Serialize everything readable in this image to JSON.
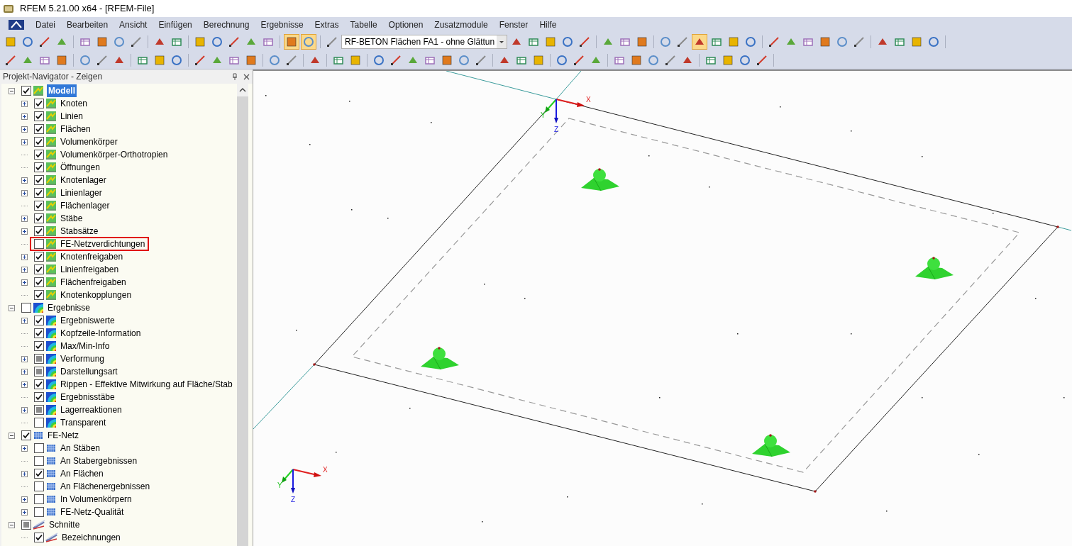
{
  "window": {
    "title": "RFEM 5.21.00 x64 - [RFEM-File]"
  },
  "menu": [
    "Datei",
    "Bearbeiten",
    "Ansicht",
    "Einfügen",
    "Berechnung",
    "Ergebnisse",
    "Extras",
    "Tabelle",
    "Optionen",
    "Zusatzmodule",
    "Fenster",
    "Hilfe"
  ],
  "toolbar": {
    "case_dropdown": "RF-BETON Flächen FA1 - ohne Glättun"
  },
  "navigator": {
    "title": "Projekt-Navigator - Zeigen",
    "tree": [
      {
        "label": "Modell",
        "kind": "model",
        "checked": true,
        "mixed": false,
        "expanded": true,
        "selected": true,
        "highlighted": false,
        "children": [
          {
            "label": "Knoten",
            "kind": "model",
            "checked": true,
            "mixed": false,
            "expandable": true,
            "selected": false,
            "highlighted": false
          },
          {
            "label": "Linien",
            "kind": "model",
            "checked": true,
            "mixed": false,
            "expandable": true,
            "selected": false,
            "highlighted": false
          },
          {
            "label": "Flächen",
            "kind": "model",
            "checked": true,
            "mixed": false,
            "expandable": true,
            "selected": false,
            "highlighted": false
          },
          {
            "label": "Volumenkörper",
            "kind": "model",
            "checked": true,
            "mixed": false,
            "expandable": true,
            "selected": false,
            "highlighted": false
          },
          {
            "label": "Volumenkörper-Orthotropien",
            "kind": "model",
            "checked": true,
            "mixed": false,
            "expandable": false,
            "selected": false,
            "highlighted": false
          },
          {
            "label": "Öffnungen",
            "kind": "model",
            "checked": true,
            "mixed": false,
            "expandable": false,
            "selected": false,
            "highlighted": false
          },
          {
            "label": "Knotenlager",
            "kind": "model",
            "checked": true,
            "mixed": false,
            "expandable": true,
            "selected": false,
            "highlighted": false
          },
          {
            "label": "Linienlager",
            "kind": "model",
            "checked": true,
            "mixed": false,
            "expandable": true,
            "selected": false,
            "highlighted": false
          },
          {
            "label": "Flächenlager",
            "kind": "model",
            "checked": true,
            "mixed": false,
            "expandable": false,
            "selected": false,
            "highlighted": false
          },
          {
            "label": "Stäbe",
            "kind": "model",
            "checked": true,
            "mixed": false,
            "expandable": true,
            "selected": false,
            "highlighted": false
          },
          {
            "label": "Stabsätze",
            "kind": "model",
            "checked": true,
            "mixed": false,
            "expandable": true,
            "selected": false,
            "highlighted": false
          },
          {
            "label": "FE-Netzverdichtungen",
            "kind": "model",
            "checked": false,
            "mixed": false,
            "expandable": false,
            "selected": false,
            "highlighted": true
          },
          {
            "label": "Knotenfreigaben",
            "kind": "model",
            "checked": true,
            "mixed": false,
            "expandable": true,
            "selected": false,
            "highlighted": false
          },
          {
            "label": "Linienfreigaben",
            "kind": "model",
            "checked": true,
            "mixed": false,
            "expandable": true,
            "selected": false,
            "highlighted": false
          },
          {
            "label": "Flächenfreigaben",
            "kind": "model",
            "checked": true,
            "mixed": false,
            "expandable": true,
            "selected": false,
            "highlighted": false
          },
          {
            "label": "Knotenkopplungen",
            "kind": "model",
            "checked": true,
            "mixed": false,
            "expandable": false,
            "selected": false,
            "highlighted": false
          }
        ]
      },
      {
        "label": "Ergebnisse",
        "kind": "results",
        "checked": false,
        "mixed": false,
        "expanded": true,
        "selected": false,
        "highlighted": false,
        "children": [
          {
            "label": "Ergebniswerte",
            "kind": "results",
            "checked": true,
            "mixed": false,
            "expandable": true,
            "selected": false,
            "highlighted": false
          },
          {
            "label": "Kopfzeile-Information",
            "kind": "results",
            "checked": true,
            "mixed": false,
            "expandable": false,
            "selected": false,
            "highlighted": false
          },
          {
            "label": "Max/Min-Info",
            "kind": "results",
            "checked": true,
            "mixed": false,
            "expandable": false,
            "selected": false,
            "highlighted": false
          },
          {
            "label": "Verformung",
            "kind": "results",
            "checked": false,
            "mixed": true,
            "expandable": true,
            "selected": false,
            "highlighted": false
          },
          {
            "label": "Darstellungsart",
            "kind": "results",
            "checked": false,
            "mixed": true,
            "expandable": true,
            "selected": false,
            "highlighted": false
          },
          {
            "label": "Rippen - Effektive Mitwirkung auf Fläche/Stab",
            "kind": "results",
            "checked": true,
            "mixed": false,
            "expandable": true,
            "selected": false,
            "highlighted": false
          },
          {
            "label": "Ergebnisstäbe",
            "kind": "results",
            "checked": true,
            "mixed": false,
            "expandable": false,
            "selected": false,
            "highlighted": false
          },
          {
            "label": "Lagerreaktionen",
            "kind": "results",
            "checked": false,
            "mixed": true,
            "expandable": true,
            "selected": false,
            "highlighted": false
          },
          {
            "label": "Transparent",
            "kind": "results",
            "checked": false,
            "mixed": false,
            "expandable": false,
            "selected": false,
            "highlighted": false
          }
        ]
      },
      {
        "label": "FE-Netz",
        "kind": "mesh",
        "checked": true,
        "mixed": false,
        "expanded": true,
        "selected": false,
        "highlighted": false,
        "children": [
          {
            "label": "An Stäben",
            "kind": "mesh",
            "checked": false,
            "mixed": false,
            "expandable": true,
            "selected": false,
            "highlighted": false
          },
          {
            "label": "An Stabergebnissen",
            "kind": "mesh",
            "checked": false,
            "mixed": false,
            "expandable": false,
            "selected": false,
            "highlighted": false
          },
          {
            "label": "An Flächen",
            "kind": "mesh",
            "checked": true,
            "mixed": false,
            "expandable": true,
            "selected": false,
            "highlighted": false
          },
          {
            "label": "An Flächenergebnissen",
            "kind": "mesh",
            "checked": false,
            "mixed": false,
            "expandable": false,
            "selected": false,
            "highlighted": false
          },
          {
            "label": "In Volumenkörpern",
            "kind": "mesh",
            "checked": false,
            "mixed": false,
            "expandable": true,
            "selected": false,
            "highlighted": false
          },
          {
            "label": "FE-Netz-Qualität",
            "kind": "mesh",
            "checked": false,
            "mixed": false,
            "expandable": true,
            "selected": false,
            "highlighted": false
          }
        ]
      },
      {
        "label": "Schnitte",
        "kind": "section",
        "checked": false,
        "mixed": true,
        "expanded": true,
        "selected": false,
        "highlighted": false,
        "children": [
          {
            "label": "Bezeichnungen",
            "kind": "section",
            "checked": true,
            "mixed": false,
            "expandable": false,
            "selected": false,
            "highlighted": false
          }
        ]
      }
    ]
  },
  "viewport": {
    "axes_top": {
      "x": "X",
      "y": "Y",
      "z": "Z"
    },
    "axes_corner": {
      "x": "X",
      "y": "Y",
      "z": "Z"
    }
  }
}
